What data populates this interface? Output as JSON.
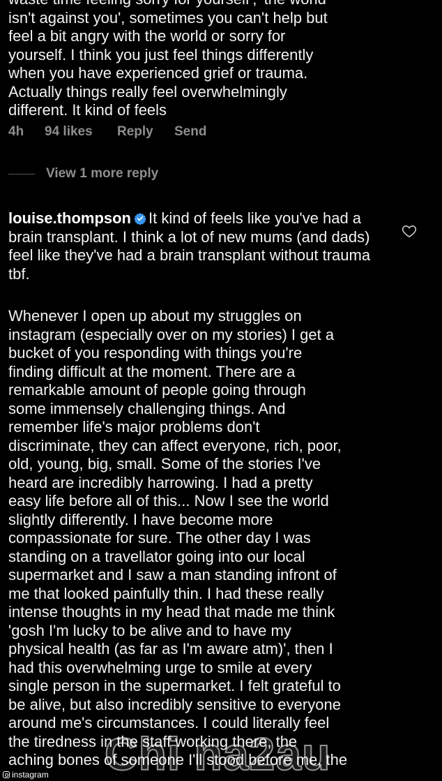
{
  "first_comment": {
    "text": "waste time feeling sorry for yourself', 'the world\nisn't against you', sometimes you can't help but\nfeel a bit angry with the world or sorry for\nyourself. I think you just feel things differently\nwhen you have experienced grief or trauma.\nActually things really feel overwhelmingly\ndifferent. It kind of feels",
    "time": "4h",
    "likes": "94 likes",
    "reply_label": "Reply",
    "send_label": "Send"
  },
  "view_more_replies": "View 1 more reply",
  "reply_comment": {
    "username": "louise.thompson",
    "text": "It kind of feels like you've had a brain transplant. I think a lot of new mums (and dads) feel like they've had a brain transplant without trauma tbf.",
    "long_text": "Whenever I open up about my struggles on\ninstagram (especially over on my stories) I get a\nbucket of you responding with things you're\nfinding difficult at the moment. There are a\nremarkable amount of people going through\nsome immensely challenging things. And\nremember life's major problems don't\ndiscriminate, they can affect everyone, rich, poor,\nold, young, big, small. Some of the stories I've\nheard are incredibly harrowing. I had a pretty\neasy life before all of this... Now I see the world\nslightly differently. I have become more\ncompassionate for sure. The other day I was\nstanding on a travellator going into our local\nsupermarket and I saw a man standing infront of\nme that looked painfully thin. I had these really\nintense thoughts in my head that made me think\n'gosh I'm lucky to be alive and to have my\nphysical health (as far as I'm aware atm)', then I\nhad this overwhelming urge to smile at every\nsingle person in the supermarket. I felt grateful to\nbe alive, but also incredibly sensitive to everyone\naround me's circumstances. I could literally feel\nthe tiredness in the staff working there, the\naching bones of someone I'll stood before me, the"
  },
  "icons": {
    "verified": "verified-badge-icon",
    "like": "heart-outline-icon",
    "source": "instagram-icon"
  },
  "watermark": "Chi na2au",
  "source_label": "instagram",
  "colors": {
    "background": "#000000",
    "text": "#f2f2f2",
    "muted": "#8e8e8e",
    "verified_blue": "#3897f0"
  }
}
